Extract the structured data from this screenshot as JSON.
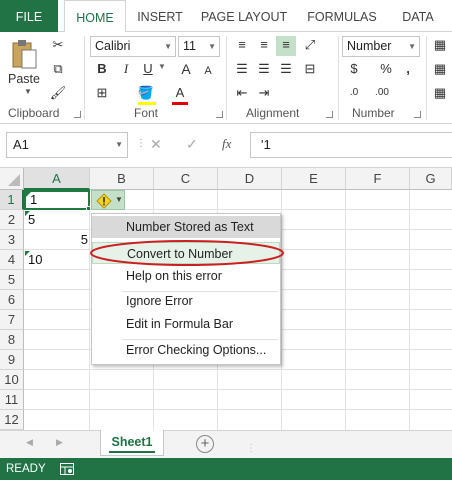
{
  "tabs": [
    {
      "label": "FILE"
    },
    {
      "label": "HOME"
    },
    {
      "label": "INSERT"
    },
    {
      "label": "PAGE LAYOUT"
    },
    {
      "label": "FORMULAS"
    },
    {
      "label": "DATA"
    }
  ],
  "ribbon": {
    "clipboard": {
      "paste_label": "Paste",
      "group_label": "Clipboard"
    },
    "font": {
      "name": "Calibri",
      "size": "11",
      "group_label": "Font",
      "bold": "B",
      "italic": "I",
      "underline": "U",
      "grow": "A",
      "shrink": "A",
      "font_color_letter": "A"
    },
    "alignment": {
      "group_label": "Alignment"
    },
    "number": {
      "format": "Number",
      "group_label": "Number",
      "currency": "$",
      "percent": "%",
      "comma": ","
    }
  },
  "formula_bar": {
    "name_box": "A1",
    "fx": "fx",
    "content": "'1"
  },
  "columns": [
    "A",
    "B",
    "C",
    "D",
    "E",
    "F",
    "G"
  ],
  "rows": [
    "1",
    "2",
    "3",
    "4",
    "5",
    "6",
    "7",
    "8",
    "9",
    "10",
    "11",
    "12"
  ],
  "cells": {
    "a1": "1",
    "a2": "5",
    "a3": "5",
    "a4": "10"
  },
  "context_menu": {
    "header": "Number Stored as Text",
    "items": [
      "Convert to Number",
      "Help on this error",
      "Ignore Error",
      "Edit in Formula Bar",
      "Error Checking Options..."
    ]
  },
  "sheets": {
    "active": "Sheet1",
    "add": "+"
  },
  "status": {
    "text": "READY"
  },
  "colors": {
    "excel_green": "#217346",
    "highlight_ring": "#cc1f1f",
    "selection": "#1e7a3e"
  }
}
